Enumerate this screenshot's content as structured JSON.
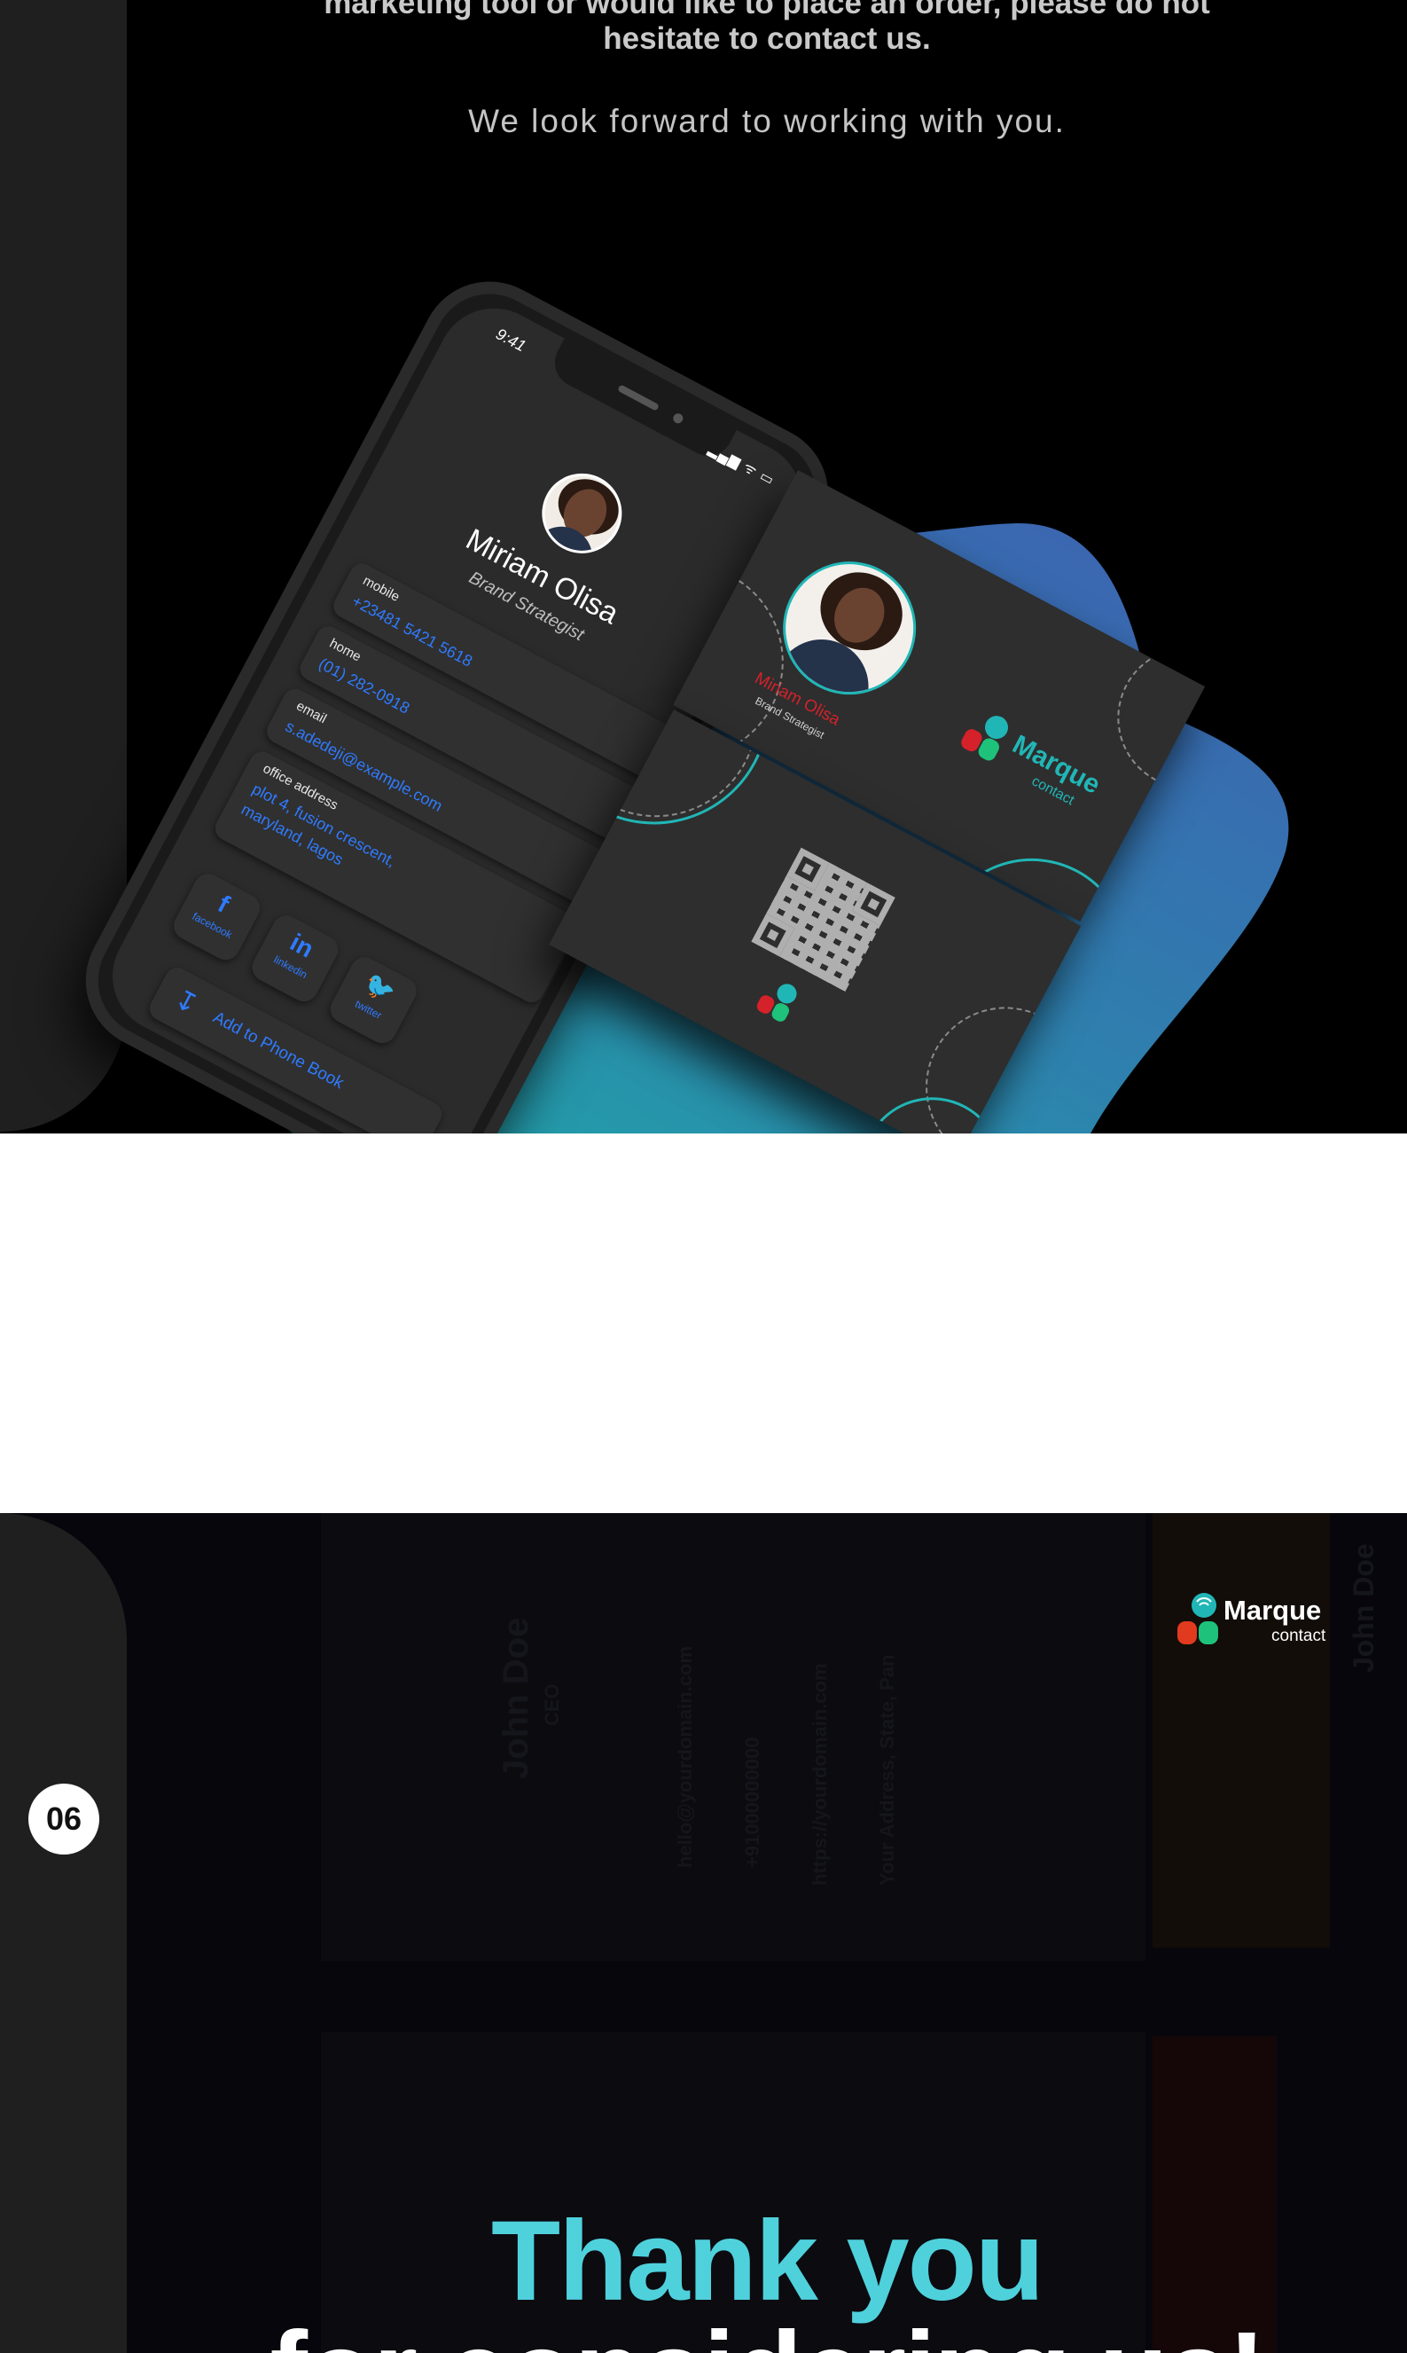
{
  "intro": {
    "line1": "marketing tool or would like to place an order, please do not",
    "line2": "hesitate to contact us.",
    "line3": "We look forward to working with you."
  },
  "phone": {
    "time": "9:41",
    "status_icons": "▂▄▆ ᯤ ▭",
    "name": "Miriam Olisa",
    "role": "Brand Strategist",
    "rows": [
      {
        "label": "mobile",
        "value": "+23481 5421 5618"
      },
      {
        "label": "home",
        "value": "(01) 282-0918"
      },
      {
        "label": "email",
        "value": "s.adedeji@example.com"
      },
      {
        "label": "office address",
        "value": "plot 4, fusion crescent,",
        "value2": "maryland, lagos"
      }
    ],
    "social": [
      {
        "glyph": "f",
        "label": "facebook"
      },
      {
        "glyph": "in",
        "label": "linkedin"
      },
      {
        "glyph": "🐦",
        "label": "twitter"
      }
    ],
    "add_book": "Add to Phone Book",
    "add_book_icon": "↧"
  },
  "card": {
    "name": "Miriam Olisa",
    "role": "Brand Strategist",
    "logo_title": "Marque",
    "logo_sub": "contact"
  },
  "bottom": {
    "slide_number": "06",
    "logo_title": "Marque",
    "logo_sub": "contact",
    "thank_line1": "Thank you",
    "thank_line2": "for considering us!",
    "ghost": [
      "John Doe",
      "CEO",
      "hello@yourdomain.com",
      "+91000000000",
      "https://yourdomain.com",
      "Your Address, State, Pan"
    ]
  },
  "colors": {
    "accent_teal": "#4fd1dc",
    "card_teal": "#21b6b6",
    "link_blue": "#2f7bff",
    "name_red": "#d4212a",
    "rail": "#1f1f1f"
  }
}
